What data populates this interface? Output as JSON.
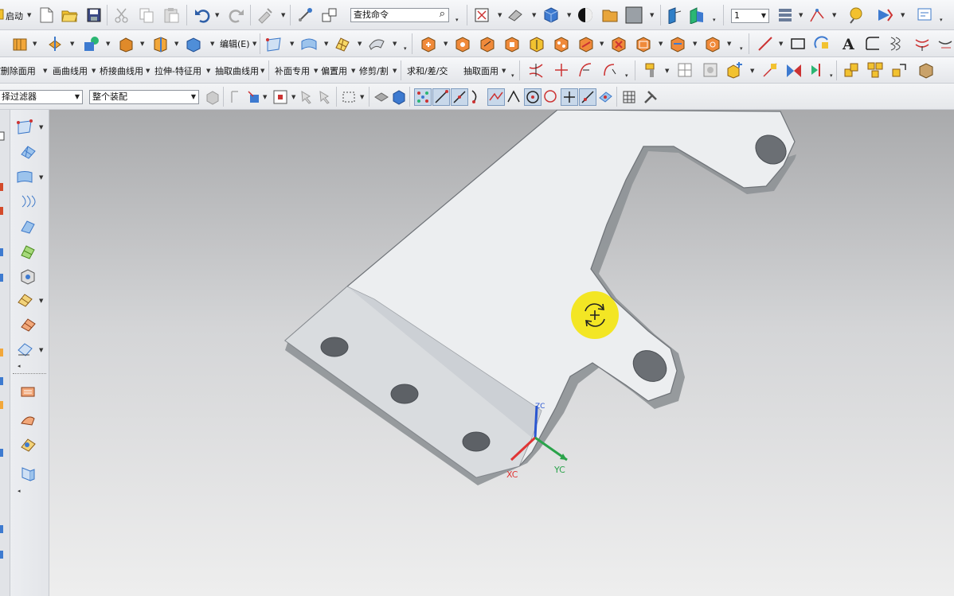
{
  "row1": {
    "start_label": "启动",
    "search_placeholder": "查找命令",
    "layer_value": "1"
  },
  "row2": {
    "edit_label": "编辑(E)"
  },
  "row3": {
    "menus": [
      "/删除面用",
      "画曲线用",
      "桥接曲线用",
      "拉伸-特征用",
      "抽取曲线用",
      "补面专用",
      "偏置用",
      "修剪/割",
      "求和/差/交",
      "抽取面用"
    ]
  },
  "row4": {
    "filter_value": "择过滤器",
    "assembly_value": "整个装配"
  },
  "viewport": {
    "axis_x": "XC",
    "axis_y": "YC",
    "axis_z": "ZC"
  },
  "colors": {
    "accent": "#3a6fb0",
    "highlight": "#f5e400",
    "part": "#eef0f2"
  }
}
